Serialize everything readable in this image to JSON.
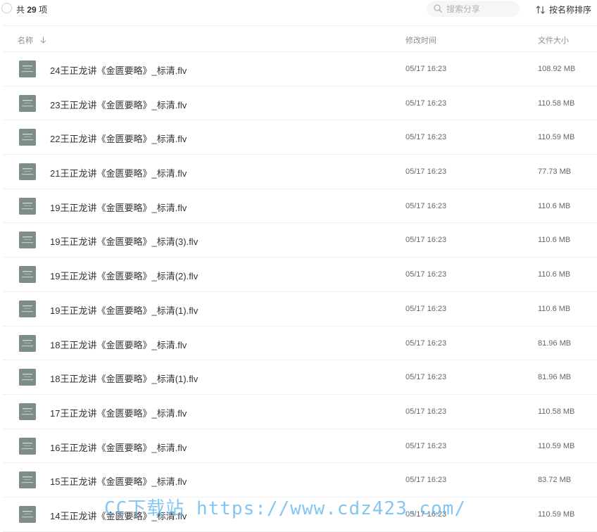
{
  "toolbar": {
    "count_prefix": "共",
    "count_value": "29",
    "count_suffix": "项",
    "search_placeholder": "搜索分享",
    "sort_label": "按名称排序"
  },
  "columns": {
    "name": "名称",
    "time": "修改时间",
    "size": "文件大小"
  },
  "files": [
    {
      "name": "24王正龙讲《金匮要略》_标清.flv",
      "time": "05/17 16:23",
      "size": "108.92 MB"
    },
    {
      "name": "23王正龙讲《金匮要略》_标清.flv",
      "time": "05/17 16:23",
      "size": "110.58 MB"
    },
    {
      "name": "22王正龙讲《金匮要略》_标清.flv",
      "time": "05/17 16:23",
      "size": "110.59 MB"
    },
    {
      "name": "21王正龙讲《金匮要略》_标清.flv",
      "time": "05/17 16:23",
      "size": "77.73 MB"
    },
    {
      "name": "19王正龙讲《金匮要略》_标清.flv",
      "time": "05/17 16:23",
      "size": "110.6 MB"
    },
    {
      "name": "19王正龙讲《金匮要略》_标清(3).flv",
      "time": "05/17 16:23",
      "size": "110.6 MB"
    },
    {
      "name": "19王正龙讲《金匮要略》_标清(2).flv",
      "time": "05/17 16:23",
      "size": "110.6 MB"
    },
    {
      "name": "19王正龙讲《金匮要略》_标清(1).flv",
      "time": "05/17 16:23",
      "size": "110.6 MB"
    },
    {
      "name": "18王正龙讲《金匮要略》_标清.flv",
      "time": "05/17 16:23",
      "size": "81.96 MB"
    },
    {
      "name": "18王正龙讲《金匮要略》_标清(1).flv",
      "time": "05/17 16:23",
      "size": "81.96 MB"
    },
    {
      "name": "17王正龙讲《金匮要略》_标清.flv",
      "time": "05/17 16:23",
      "size": "110.58 MB"
    },
    {
      "name": "16王正龙讲《金匮要略》_标清.flv",
      "time": "05/17 16:23",
      "size": "110.59 MB"
    },
    {
      "name": "15王正龙讲《金匮要略》_标清.flv",
      "time": "05/17 16:23",
      "size": "83.72 MB"
    },
    {
      "name": "14王正龙讲《金匮要略》_标清.flv",
      "time": "05/17 16:23",
      "size": "110.59 MB"
    }
  ],
  "watermark": "CC下载站 https://www.cdz423.com/"
}
